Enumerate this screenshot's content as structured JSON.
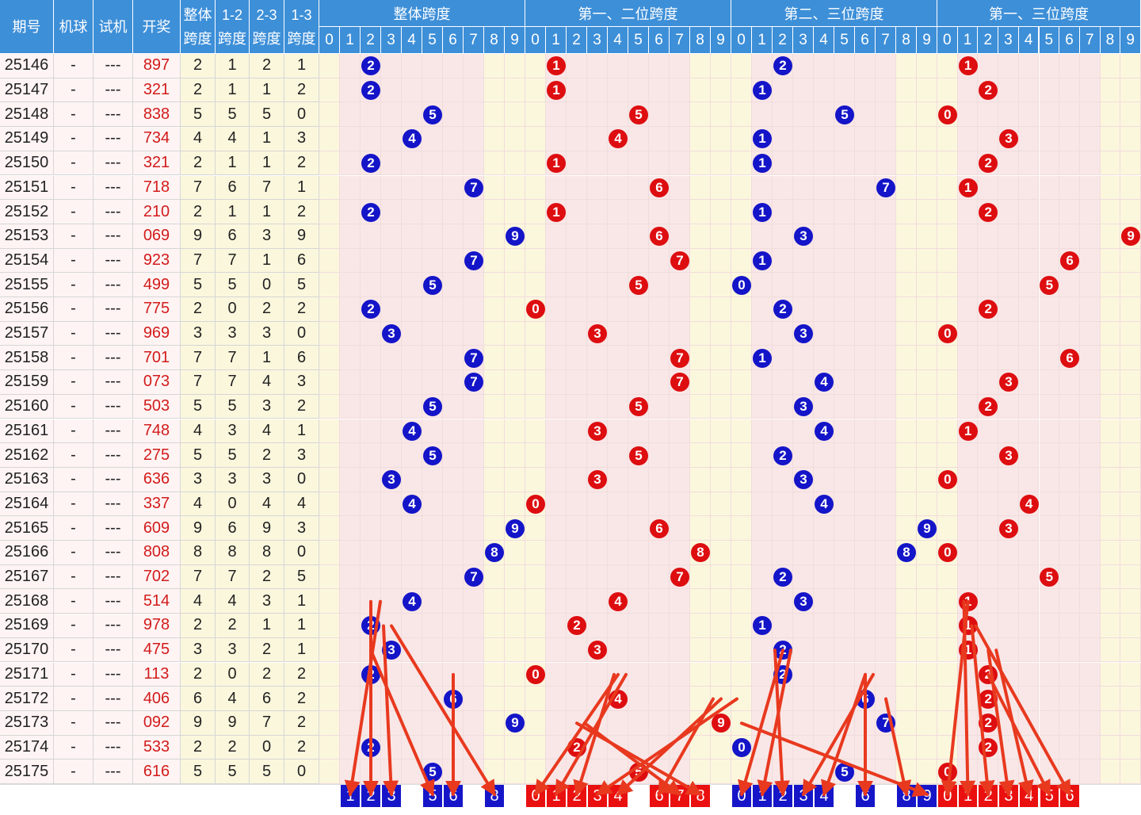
{
  "chart_data": {
    "type": "table",
    "columns": [
      "期号",
      "机球",
      "试机",
      "开奖",
      "整体跨度",
      "1-2跨度",
      "2-3跨度",
      "1-3跨度"
    ],
    "column_header_lines": [
      [
        "期号"
      ],
      [
        "机球"
      ],
      [
        "试机"
      ],
      [
        "开奖"
      ],
      [
        "整体",
        "跨度"
      ],
      [
        "1-2",
        "跨度"
      ],
      [
        "2-3",
        "跨度"
      ],
      [
        "1-3",
        "跨度"
      ]
    ],
    "sections": [
      "整体跨度",
      "第一、二位跨度",
      "第二、三位跨度",
      "第一、三位跨度"
    ],
    "digits": [
      0,
      1,
      2,
      3,
      4,
      5,
      6,
      7,
      8,
      9
    ],
    "rows": [
      {
        "issue": "25146",
        "machine": "-",
        "trial": "---",
        "draw": "897",
        "spans": [
          2,
          1,
          2,
          1
        ]
      },
      {
        "issue": "25147",
        "machine": "-",
        "trial": "---",
        "draw": "321",
        "spans": [
          2,
          1,
          1,
          2
        ]
      },
      {
        "issue": "25148",
        "machine": "-",
        "trial": "---",
        "draw": "838",
        "spans": [
          5,
          5,
          5,
          0
        ]
      },
      {
        "issue": "25149",
        "machine": "-",
        "trial": "---",
        "draw": "734",
        "spans": [
          4,
          4,
          1,
          3
        ]
      },
      {
        "issue": "25150",
        "machine": "-",
        "trial": "---",
        "draw": "321",
        "spans": [
          2,
          1,
          1,
          2
        ]
      },
      {
        "issue": "25151",
        "machine": "-",
        "trial": "---",
        "draw": "718",
        "spans": [
          7,
          6,
          7,
          1
        ]
      },
      {
        "issue": "25152",
        "machine": "-",
        "trial": "---",
        "draw": "210",
        "spans": [
          2,
          1,
          1,
          2
        ]
      },
      {
        "issue": "25153",
        "machine": "-",
        "trial": "---",
        "draw": "069",
        "spans": [
          9,
          6,
          3,
          9
        ]
      },
      {
        "issue": "25154",
        "machine": "-",
        "trial": "---",
        "draw": "923",
        "spans": [
          7,
          7,
          1,
          6
        ]
      },
      {
        "issue": "25155",
        "machine": "-",
        "trial": "---",
        "draw": "499",
        "spans": [
          5,
          5,
          0,
          5
        ]
      },
      {
        "issue": "25156",
        "machine": "-",
        "trial": "---",
        "draw": "775",
        "spans": [
          2,
          0,
          2,
          2
        ]
      },
      {
        "issue": "25157",
        "machine": "-",
        "trial": "---",
        "draw": "969",
        "spans": [
          3,
          3,
          3,
          0
        ]
      },
      {
        "issue": "25158",
        "machine": "-",
        "trial": "---",
        "draw": "701",
        "spans": [
          7,
          7,
          1,
          6
        ]
      },
      {
        "issue": "25159",
        "machine": "-",
        "trial": "---",
        "draw": "073",
        "spans": [
          7,
          7,
          4,
          3
        ]
      },
      {
        "issue": "25160",
        "machine": "-",
        "trial": "---",
        "draw": "503",
        "spans": [
          5,
          5,
          3,
          2
        ]
      },
      {
        "issue": "25161",
        "machine": "-",
        "trial": "---",
        "draw": "748",
        "spans": [
          4,
          3,
          4,
          1
        ]
      },
      {
        "issue": "25162",
        "machine": "-",
        "trial": "---",
        "draw": "275",
        "spans": [
          5,
          5,
          2,
          3
        ]
      },
      {
        "issue": "25163",
        "machine": "-",
        "trial": "---",
        "draw": "636",
        "spans": [
          3,
          3,
          3,
          0
        ]
      },
      {
        "issue": "25164",
        "machine": "-",
        "trial": "---",
        "draw": "337",
        "spans": [
          4,
          0,
          4,
          4
        ]
      },
      {
        "issue": "25165",
        "machine": "-",
        "trial": "---",
        "draw": "609",
        "spans": [
          9,
          6,
          9,
          3
        ]
      },
      {
        "issue": "25166",
        "machine": "-",
        "trial": "---",
        "draw": "808",
        "spans": [
          8,
          8,
          8,
          0
        ]
      },
      {
        "issue": "25167",
        "machine": "-",
        "trial": "---",
        "draw": "702",
        "spans": [
          7,
          7,
          2,
          5
        ]
      },
      {
        "issue": "25168",
        "machine": "-",
        "trial": "---",
        "draw": "514",
        "spans": [
          4,
          4,
          3,
          1
        ]
      },
      {
        "issue": "25169",
        "machine": "-",
        "trial": "---",
        "draw": "978",
        "spans": [
          2,
          2,
          1,
          1
        ]
      },
      {
        "issue": "25170",
        "machine": "-",
        "trial": "---",
        "draw": "475",
        "spans": [
          3,
          3,
          2,
          1
        ]
      },
      {
        "issue": "25171",
        "machine": "-",
        "trial": "---",
        "draw": "113",
        "spans": [
          2,
          0,
          2,
          2
        ]
      },
      {
        "issue": "25172",
        "machine": "-",
        "trial": "---",
        "draw": "406",
        "spans": [
          6,
          4,
          6,
          2
        ]
      },
      {
        "issue": "25173",
        "machine": "-",
        "trial": "---",
        "draw": "092",
        "spans": [
          9,
          9,
          7,
          2
        ]
      },
      {
        "issue": "25174",
        "machine": "-",
        "trial": "---",
        "draw": "533",
        "spans": [
          2,
          2,
          0,
          2
        ]
      },
      {
        "issue": "25175",
        "machine": "-",
        "trial": "---",
        "draw": "616",
        "spans": [
          5,
          5,
          5,
          0
        ]
      }
    ],
    "predicted_digits": [
      [
        1,
        2,
        3,
        5,
        6,
        8
      ],
      [
        0,
        1,
        2,
        3,
        4,
        6,
        7,
        8
      ],
      [
        0,
        1,
        2,
        3,
        4,
        6,
        8,
        9
      ],
      [
        0,
        1,
        2,
        3,
        4,
        5,
        6
      ]
    ],
    "colors": {
      "header": "#3d8fd8",
      "blue_ball": "#1414c8",
      "red_ball": "#dd0d10",
      "draw_text": "#d21b1b",
      "arrow": "#e8391f",
      "pink_bg": "#f9e7e7",
      "yellow_bg": "#fbf7dd"
    }
  }
}
